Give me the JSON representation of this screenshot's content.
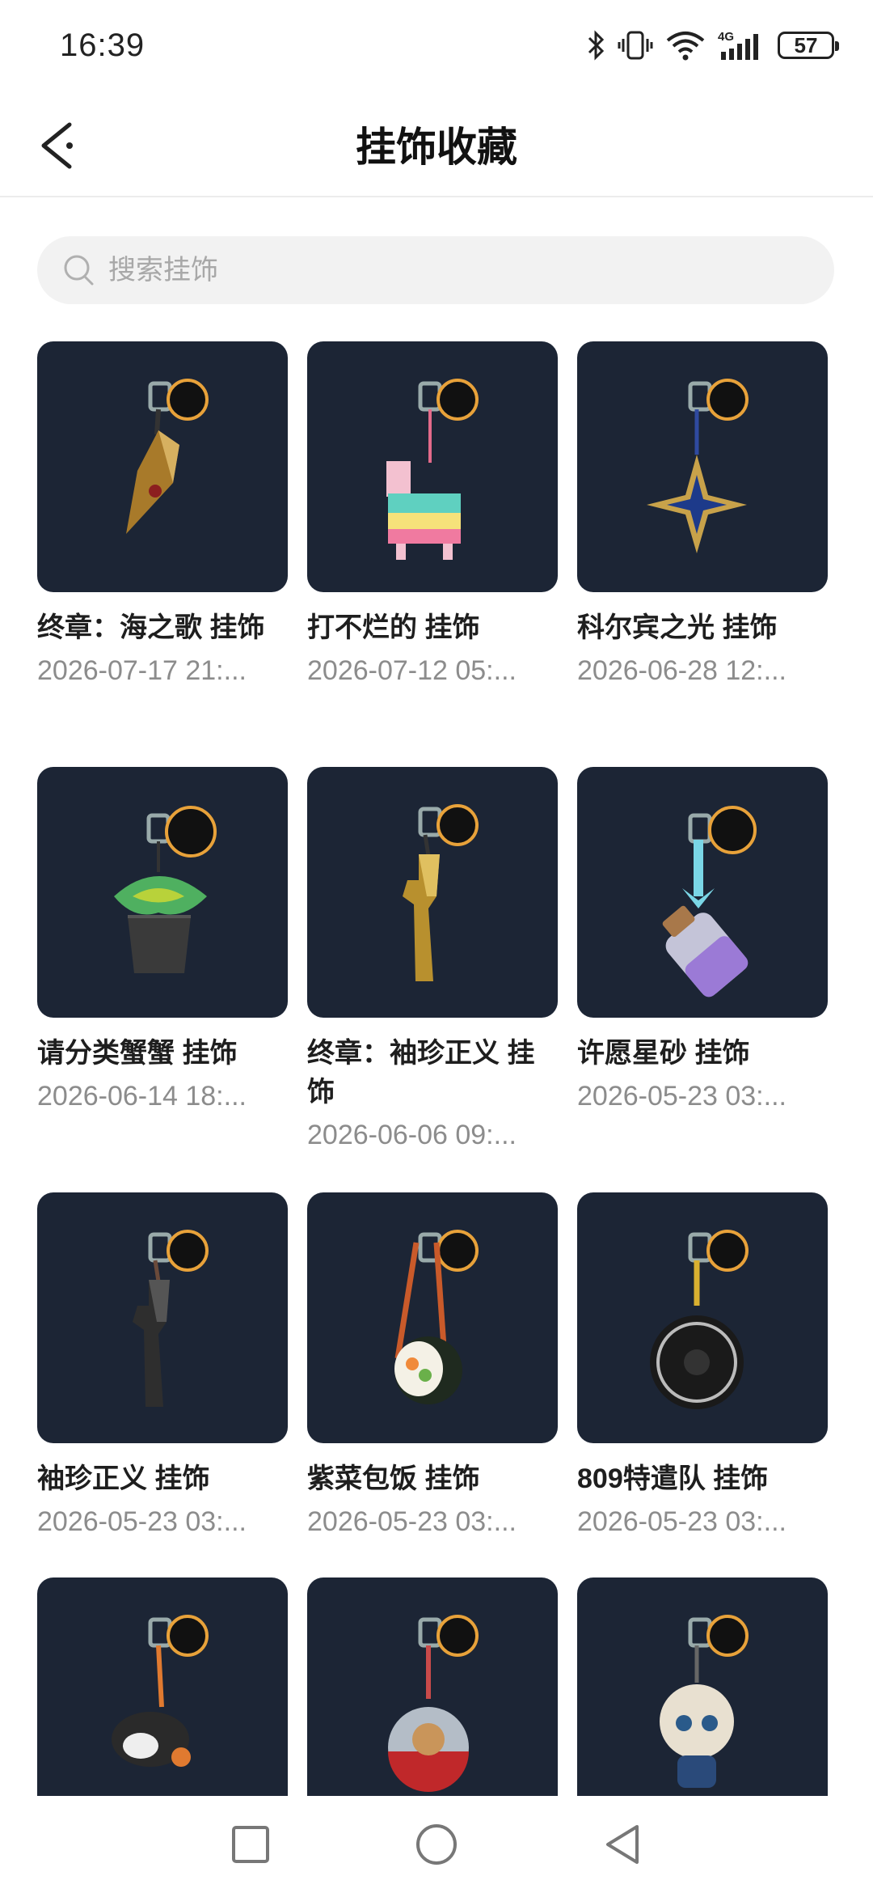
{
  "status": {
    "time": "16:39",
    "battery": "57"
  },
  "header": {
    "title": "挂饰收藏"
  },
  "search": {
    "placeholder": "搜索挂饰"
  },
  "items": [
    {
      "name": " 终章：海之歌 挂饰",
      "date": "2026-07-17 21:...",
      "art": "shell"
    },
    {
      "name": " 打不烂的 挂饰",
      "date": "2026-07-12 05:...",
      "art": "pinata"
    },
    {
      "name": "科尔宾之光  挂饰",
      "date": "2026-06-28 12:...",
      "art": "star"
    },
    {
      "name": "请分类蟹蟹 挂饰",
      "date": "2026-06-14 18:...",
      "art": "crab"
    },
    {
      "name": " 终章：袖珍正义 挂饰",
      "date": "2026-06-06 09:...",
      "art": "gun-gold"
    },
    {
      "name": "许愿星砂 挂饰",
      "date": "2026-05-23 03:...",
      "art": "bottle"
    },
    {
      "name": " 袖珍正义 挂饰",
      "date": "2026-05-23 03:...",
      "art": "gun-dark"
    },
    {
      "name": " 紫菜包饭 挂饰",
      "date": "2026-05-23 03:...",
      "art": "sushi"
    },
    {
      "name": " 809特遣队 挂饰",
      "date": "2026-05-23 03:...",
      "art": "pan"
    },
    {
      "name": "",
      "date": "",
      "art": "cat"
    },
    {
      "name": "",
      "date": "",
      "art": "capsule"
    },
    {
      "name": "",
      "date": "",
      "art": "doll"
    }
  ],
  "colors": {
    "card_bg": "#1c2535",
    "accent_ring": "#e8a23a"
  }
}
